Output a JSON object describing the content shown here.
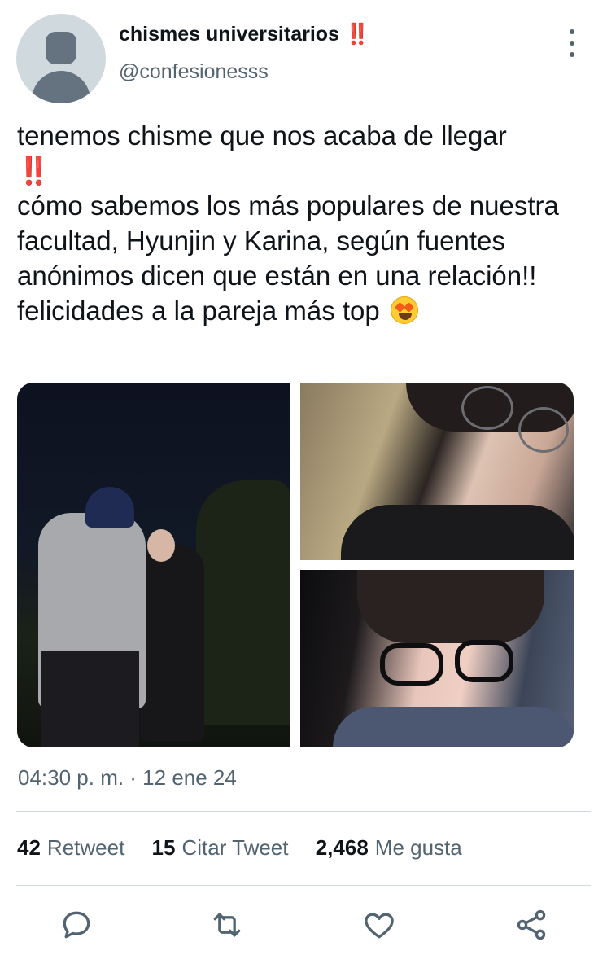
{
  "author": {
    "name": "chismes universitarios",
    "name_suffix": "‼️",
    "handle": "@confesionesss",
    "avatar": "default-avatar"
  },
  "tweet": {
    "lines": [
      "tenemos chisme que nos acaba de llegar",
      "‼️",
      "cómo sabemos los más populares de nuestra facultad, Hyunjin y Karina, según fuentes anónimos dicen que están en una relación!!",
      "felicidades a la pareja más top"
    ],
    "emoji": "star-struck-emoji",
    "timestamp": "04:30 p. m. · 12 ene 24"
  },
  "media": {
    "images": [
      "couple-night-photo",
      "hyunjin-selfie-photo",
      "karina-selfie-photo"
    ]
  },
  "stats": [
    {
      "count": "42",
      "label": "Retweet"
    },
    {
      "count": "15",
      "label": "Citar Tweet"
    },
    {
      "count": "2,468",
      "label": "Me gusta"
    }
  ],
  "actions": [
    "reply-icon",
    "retweet-icon",
    "like-icon",
    "share-icon"
  ],
  "colors": {
    "primary_text": "#0f1419",
    "secondary_text": "#536471",
    "divider": "#cfd9de",
    "accent_red": "#e0262d"
  }
}
